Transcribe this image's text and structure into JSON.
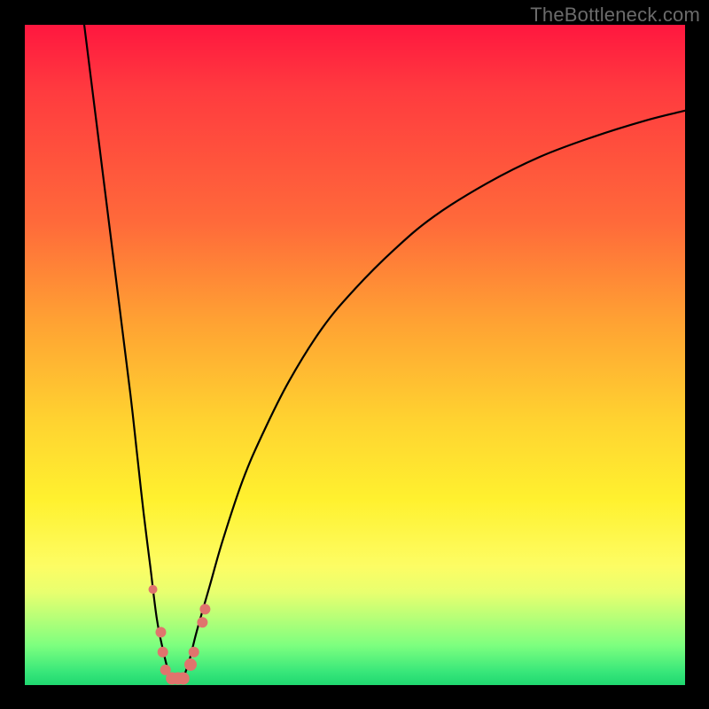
{
  "watermark": "TheBottleneck.com",
  "chart_data": {
    "type": "line",
    "title": "",
    "xlabel": "",
    "ylabel": "",
    "xlim": [
      0,
      100
    ],
    "ylim": [
      0,
      100
    ],
    "grid": false,
    "legend": false,
    "description": "Bottleneck mismatch curve: two limbs descending from high mismatch toward a minimum around x≈22, left limb from upper-left corner, right limb rising toward the right edge. Background heat gradient encodes mismatch severity (red=high, green=low).",
    "minimum_x": 22,
    "series": [
      {
        "name": "left-limb",
        "x": [
          9,
          10,
          12,
          14,
          16,
          17,
          18,
          19,
          20,
          21,
          22
        ],
        "y": [
          100,
          92,
          76,
          60,
          44,
          35,
          26,
          18,
          10,
          5,
          1
        ]
      },
      {
        "name": "right-limb",
        "x": [
          24,
          25,
          26,
          28,
          30,
          33,
          36,
          40,
          45,
          50,
          56,
          62,
          70,
          78,
          86,
          94,
          100
        ],
        "y": [
          1,
          4,
          8,
          15,
          22,
          31,
          38,
          46,
          54,
          60,
          66,
          71,
          76,
          80,
          83,
          85.5,
          87
        ]
      }
    ],
    "markers": {
      "name": "bottleneck-markers",
      "color": "#e0746d",
      "points": [
        {
          "x": 19.4,
          "y": 14.5,
          "r": 5
        },
        {
          "x": 20.6,
          "y": 8.0,
          "r": 6
        },
        {
          "x": 20.9,
          "y": 5.0,
          "r": 6
        },
        {
          "x": 21.3,
          "y": 2.3,
          "r": 6
        },
        {
          "x": 22.3,
          "y": 1.0,
          "r": 7
        },
        {
          "x": 23.2,
          "y": 1.0,
          "r": 7
        },
        {
          "x": 24.0,
          "y": 1.0,
          "r": 7
        },
        {
          "x": 25.1,
          "y": 3.1,
          "r": 7
        },
        {
          "x": 25.6,
          "y": 5.0,
          "r": 6
        },
        {
          "x": 26.9,
          "y": 9.5,
          "r": 6
        },
        {
          "x": 27.3,
          "y": 11.5,
          "r": 6
        }
      ]
    },
    "gradient_stops": [
      {
        "pct": 0,
        "color": "#ff173f",
        "meaning": "severe bottleneck"
      },
      {
        "pct": 50,
        "color": "#ffb733",
        "meaning": "moderate"
      },
      {
        "pct": 80,
        "color": "#fff12f",
        "meaning": "mild"
      },
      {
        "pct": 100,
        "color": "#1fd870",
        "meaning": "balanced"
      }
    ]
  }
}
